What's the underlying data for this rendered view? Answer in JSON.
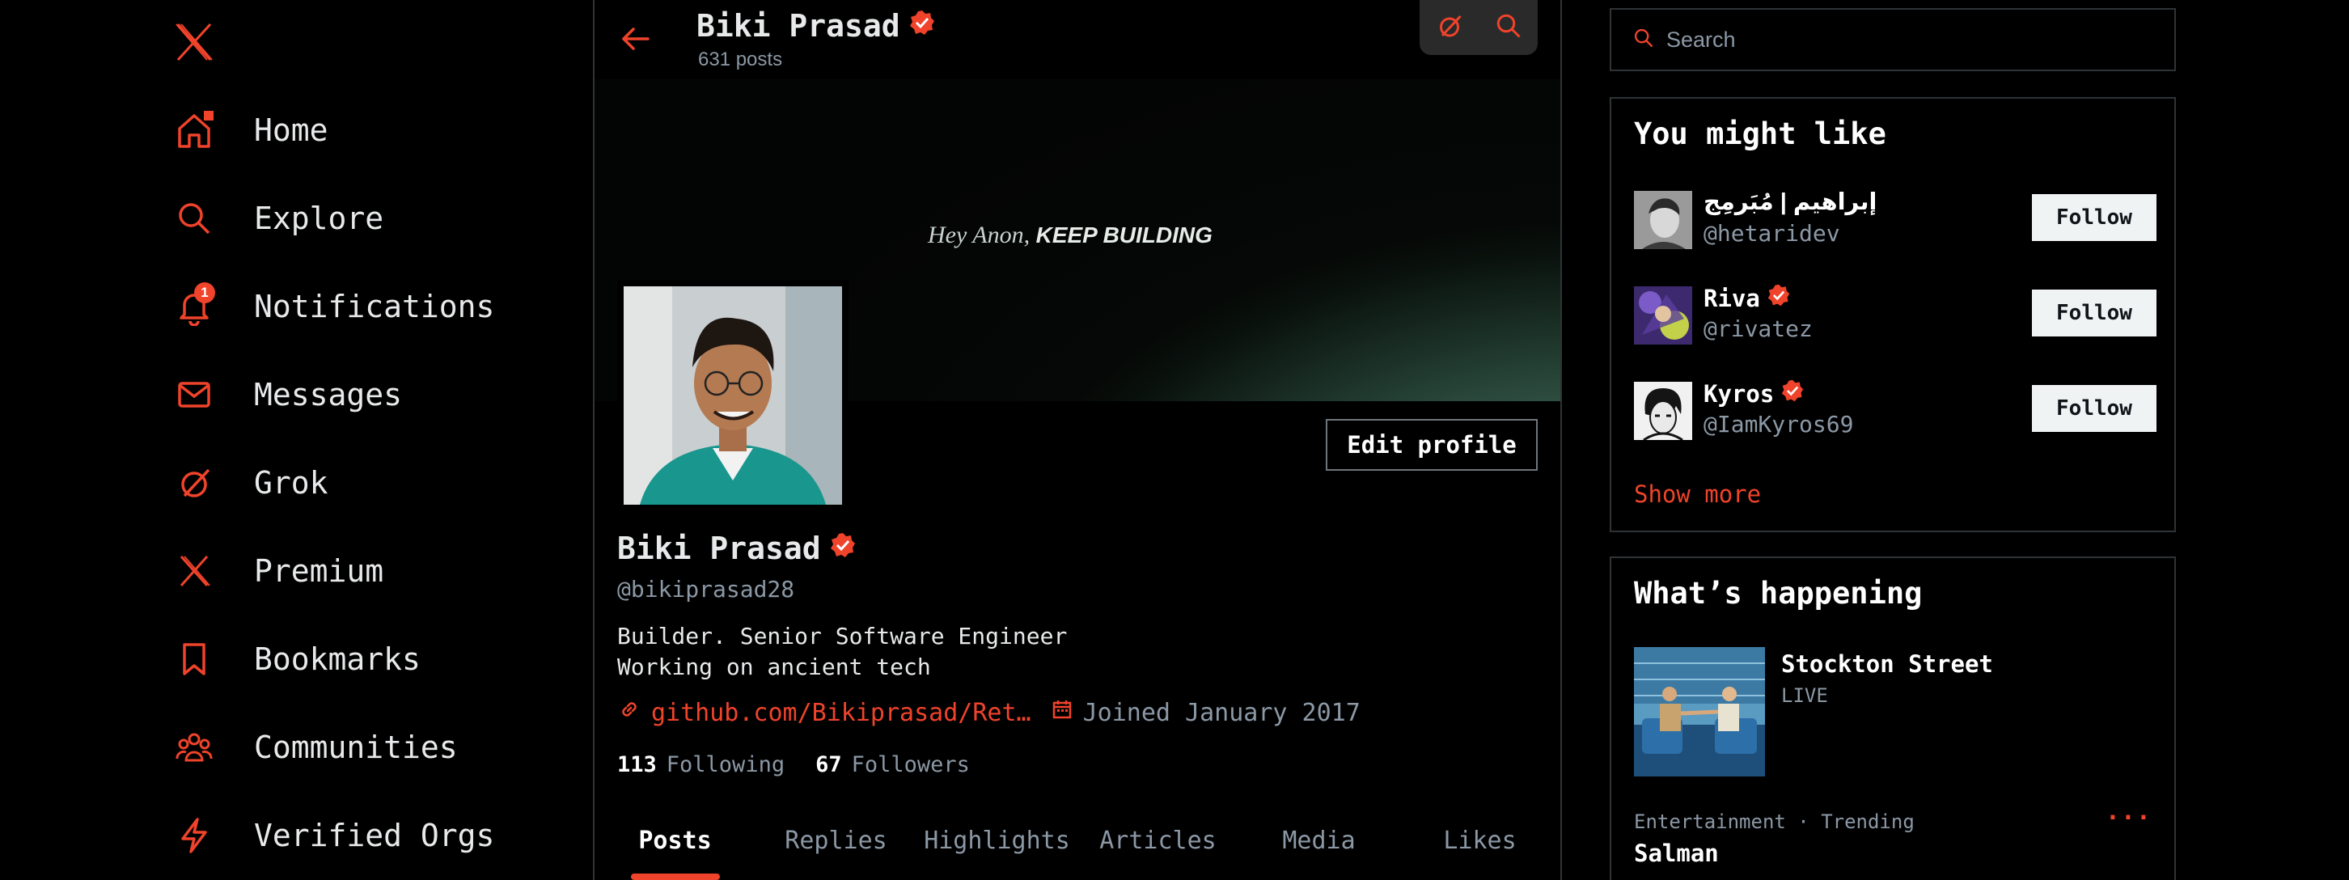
{
  "colors": {
    "accent": "#f0432b",
    "background": "#000000",
    "border": "#2f3336",
    "muted": "#8b98a5"
  },
  "nav": {
    "logo_icon": "x-logo-icon",
    "items": [
      {
        "label": "Home",
        "icon": "home-icon"
      },
      {
        "label": "Explore",
        "icon": "search-icon"
      },
      {
        "label": "Notifications",
        "icon": "bell-icon",
        "badge": "1"
      },
      {
        "label": "Messages",
        "icon": "mail-icon"
      },
      {
        "label": "Grok",
        "icon": "grok-icon"
      },
      {
        "label": "Premium",
        "icon": "x-logo-icon"
      },
      {
        "label": "Bookmarks",
        "icon": "bookmark-icon"
      },
      {
        "label": "Communities",
        "icon": "people-icon"
      },
      {
        "label": "Verified Orgs",
        "icon": "lightning-icon"
      }
    ]
  },
  "header": {
    "name": "Biki Prasad",
    "posts": "631 posts"
  },
  "banner": {
    "prefix": "Hey Anon,",
    "emphasis": "KEEP BUILDING"
  },
  "profile": {
    "edit_label": "Edit profile",
    "name": "Biki Prasad",
    "handle": "@bikiprasad28",
    "bio_line1": "Builder. Senior Software Engineer",
    "bio_line2": "Working on ancient tech",
    "link": "github.com/Bikiprasad/Ret…",
    "joined": "Joined January 2017",
    "following_count": "113",
    "following_label": "Following",
    "followers_count": "67",
    "followers_label": "Followers"
  },
  "tabs": [
    "Posts",
    "Replies",
    "Highlights",
    "Articles",
    "Media",
    "Likes"
  ],
  "active_tab": "Posts",
  "search": {
    "placeholder": "Search"
  },
  "suggestions": {
    "title": "You might like",
    "follow_label": "Follow",
    "show_more": "Show more",
    "items": [
      {
        "name": "إبراهيم | مُبَرمِج",
        "handle": "@hetaridev",
        "verified": false
      },
      {
        "name": "Riva",
        "handle": "@rivatez",
        "verified": true
      },
      {
        "name": "Kyros",
        "handle": "@IamKyros69",
        "verified": true
      }
    ]
  },
  "trends": {
    "title": "What’s happening",
    "featured_title": "Stockton Street",
    "featured_status": "LIVE",
    "item_category": "Entertainment · Trending",
    "item_title": "Salman",
    "item_more": "···"
  }
}
